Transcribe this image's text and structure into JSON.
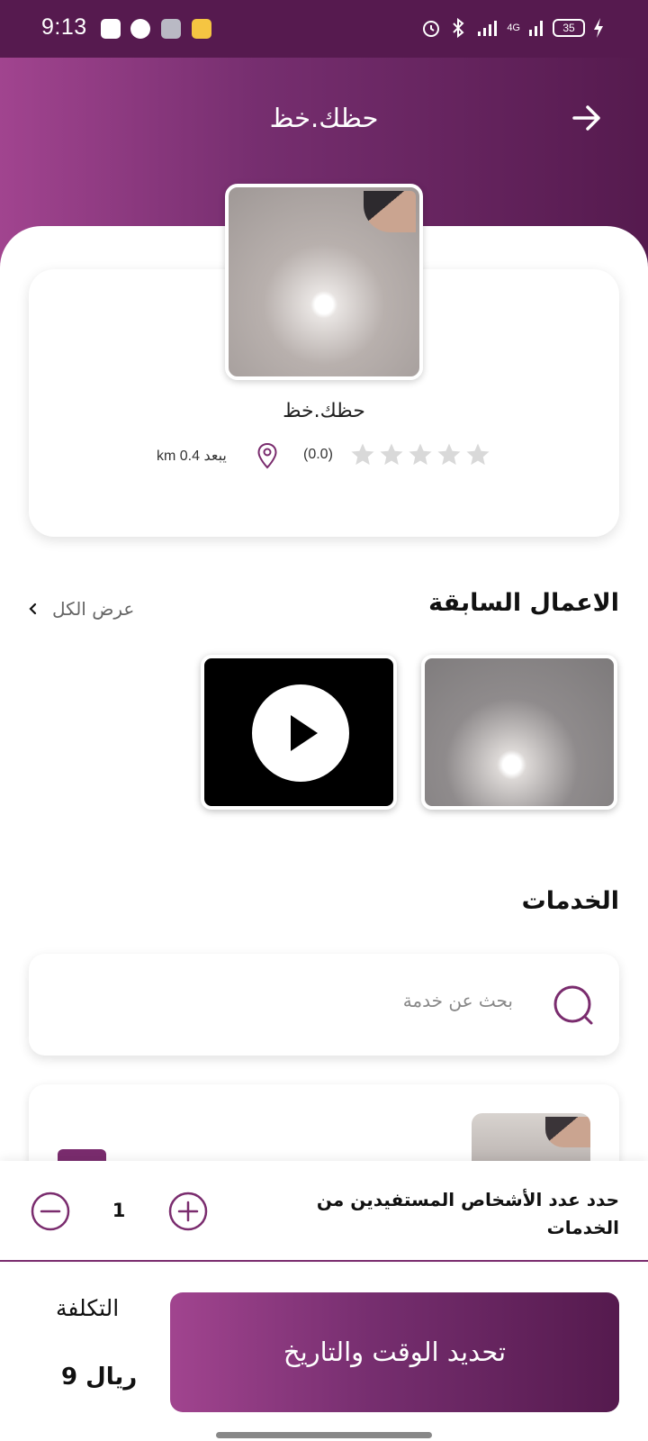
{
  "status_bar": {
    "time": "9:13",
    "battery": "35",
    "network": "4G"
  },
  "header": {
    "title": "حظك.خظ",
    "back_icon": "arrow-right-icon"
  },
  "profile": {
    "name": "حظك.خظ",
    "rating": "(0.0)",
    "stars_filled": 0,
    "stars_total": 5,
    "distance": "km 0.4 يبعد"
  },
  "previous_works": {
    "title": "الاعمال السابقة",
    "view_all": "عرض الكل"
  },
  "services": {
    "title": "الخدمات",
    "search_placeholder": "بحث عن خدمة"
  },
  "beneficiaries": {
    "label": "حدد عدد الأشخاص المستفيدين من الخدمات",
    "quantity": "1"
  },
  "footer": {
    "cost_label": "التكلفة",
    "cost_value": "9 ريال",
    "schedule_button": "تحديد الوقت والتاريخ"
  },
  "colors": {
    "brand_dark": "#551a4e",
    "brand_light": "#a1448f",
    "star_empty": "#d9d9d9"
  }
}
